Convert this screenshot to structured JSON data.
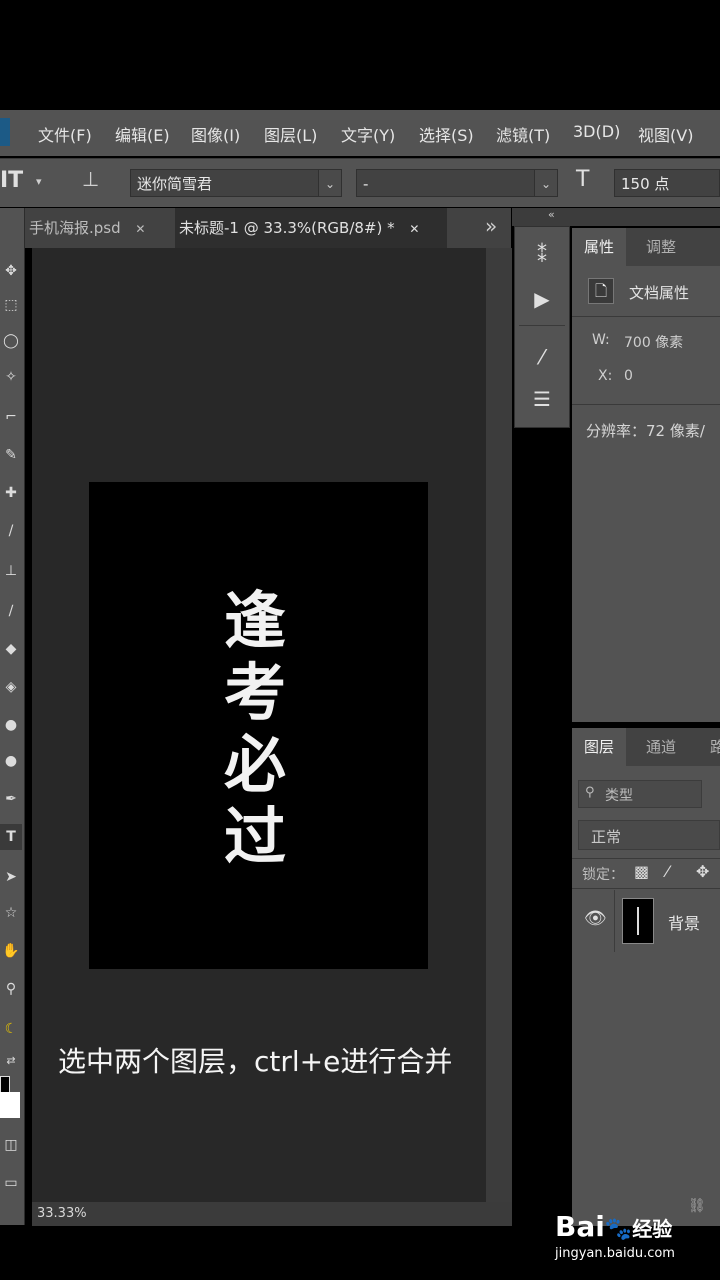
{
  "menu": [
    "文件(F)",
    "编辑(E)",
    "图像(I)",
    "图层(L)",
    "文字(Y)",
    "选择(S)",
    "滤镜(T)",
    "3D(D)",
    "视图(V)"
  ],
  "options": {
    "font_family": "迷你简雪君",
    "font_style": "-",
    "font_size": "150 点"
  },
  "tabs": {
    "inactive": "手机海报.psd",
    "active": "未标题-1 @ 33.3%(RGB/8#) *",
    "close": "✕",
    "more": "»"
  },
  "canvas": {
    "chars": [
      "逢",
      "考",
      "必",
      "过"
    ],
    "background_color": "#000000",
    "text_color": "#f2f2f2"
  },
  "status": {
    "zoom": "33.33%"
  },
  "properties": {
    "tab_active": "属性",
    "tab_inactive": "调整",
    "doc_label": "文档属性",
    "width_label": "W:",
    "width_value": "700 像素",
    "x_label": "X:",
    "x_value": "0",
    "resolution": "分辨率：72 像素/"
  },
  "layers": {
    "tab_active": "图层",
    "tab_inactive": "通道",
    "tab_third": "路",
    "filter": "类型",
    "blend_mode": "正常",
    "lock_label": "锁定：",
    "layer_name": "背景"
  },
  "caption": "选中两个图层，ctrl+e进行合并",
  "watermark": {
    "brand": "Bai",
    "brand_suffix": "经验",
    "url": "jingyan.baidu.com"
  },
  "icons": [
    "eye-icon",
    "document-icon",
    "search-icon",
    "type-tool-icon",
    "link-icon"
  ],
  "colors": {
    "accent": "#1c5a86",
    "panel": "#535353",
    "doc_bg": "#282828"
  }
}
